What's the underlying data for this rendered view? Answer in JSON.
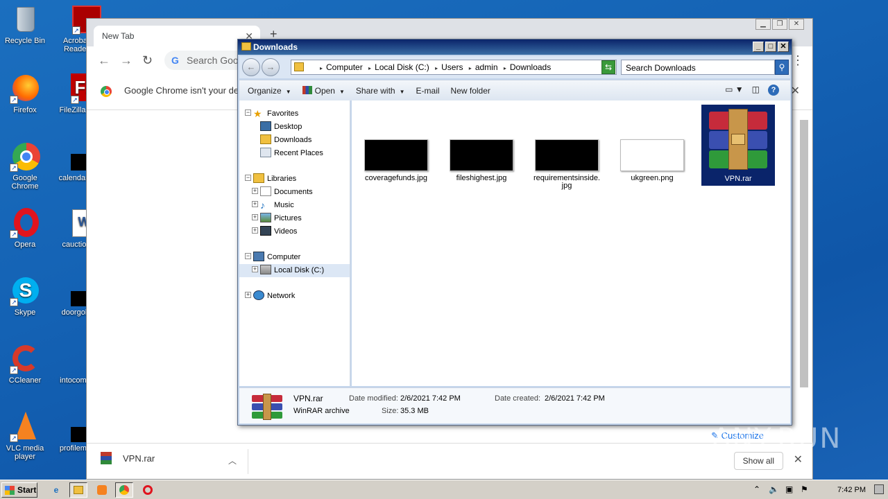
{
  "desktop": {
    "icons": [
      {
        "label": "Recycle Bin"
      },
      {
        "label": "Acrobat Reader"
      },
      {
        "label": "Firefox"
      },
      {
        "label": "FileZilla C"
      },
      {
        "label": "Google Chrome"
      },
      {
        "label": "calendarin"
      },
      {
        "label": "Opera"
      },
      {
        "label": "cauction"
      },
      {
        "label": "Skype"
      },
      {
        "label": "doorgold"
      },
      {
        "label": "CCleaner"
      },
      {
        "label": "intocomm"
      },
      {
        "label": "VLC media player"
      },
      {
        "label": "profilemat"
      }
    ]
  },
  "chrome": {
    "tab_title": "New Tab",
    "omnibox_placeholder": "Search Goog",
    "infobar_text": "Google Chrome isn't your defa",
    "customize_label": "Customize",
    "download": {
      "filename": "VPN.rar",
      "show_all": "Show all"
    }
  },
  "explorer": {
    "title": "Downloads",
    "breadcrumb": [
      "Computer",
      "Local Disk (C:)",
      "Users",
      "admin",
      "Downloads"
    ],
    "search_placeholder": "Search Downloads",
    "commands": {
      "organize": "Organize",
      "open": "Open",
      "share": "Share with",
      "email": "E-mail",
      "new_folder": "New folder"
    },
    "nav": {
      "favorites": "Favorites",
      "desktop": "Desktop",
      "downloads": "Downloads",
      "recent": "Recent Places",
      "libraries": "Libraries",
      "documents": "Documents",
      "music": "Music",
      "pictures": "Pictures",
      "videos": "Videos",
      "computer": "Computer",
      "local_disk": "Local Disk (C:)",
      "network": "Network"
    },
    "files": [
      {
        "name": "coveragefunds.jpg"
      },
      {
        "name": "fileshighest.jpg"
      },
      {
        "name": "requirementsinside.",
        "name2": "jpg"
      },
      {
        "name": "ukgreen.png"
      },
      {
        "name": "VPN.rar"
      }
    ],
    "details": {
      "name": "VPN.rar",
      "type": "WinRAR archive",
      "modified_label": "Date modified:",
      "modified": "2/6/2021 7:42 PM",
      "created_label": "Date created:",
      "created": "2/6/2021 7:42 PM",
      "size_label": "Size:",
      "size": "35.3 MB"
    }
  },
  "taskbar": {
    "start": "Start",
    "clock": "7:42 PM"
  },
  "watermark": "ANY.RUN"
}
